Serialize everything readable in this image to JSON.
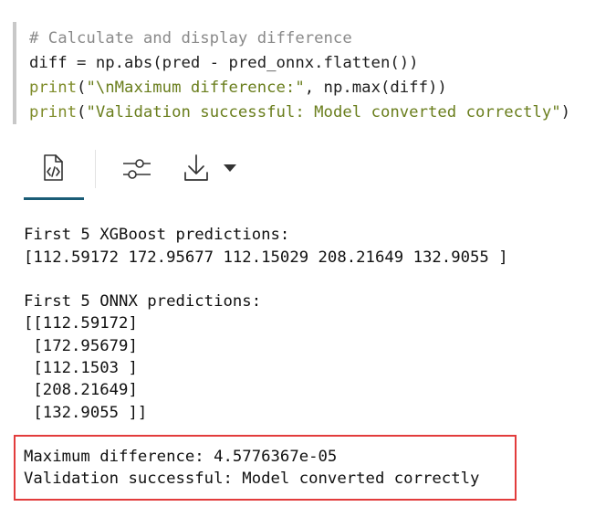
{
  "code": {
    "line1": "# Calculate and display difference",
    "line2": "diff = np.abs(pred - pred_onnx.flatten())",
    "line3_kw": "print",
    "line3_str": "\"\\nMaximum difference:\"",
    "line3_rest": ", np.max(diff))",
    "line4_kw": "print",
    "line4_str": "\"Validation successful: Model converted correctly\"",
    "line4_rest": ")"
  },
  "toolbar": {
    "icons": [
      "code-file-icon",
      "sliders-icon",
      "download-icon",
      "caret-down-icon"
    ]
  },
  "output": {
    "lines": [
      "First 5 XGBoost predictions:",
      "[112.59172 172.95677 112.15029 208.21649 132.9055 ]",
      "First 5 ONNX predictions:",
      "[[112.59172]",
      " [172.95679]",
      " [112.1503 ]",
      " [208.21649]",
      " [132.9055 ]]",
      "Maximum difference: 4.5776367e-05",
      "Validation successful: Model converted correctly"
    ]
  },
  "colors": {
    "highlight_border": "#e23c3c",
    "tab_active": "#1a5c76",
    "comment": "#8a8a8a",
    "keyword": "#7f8c2a"
  }
}
